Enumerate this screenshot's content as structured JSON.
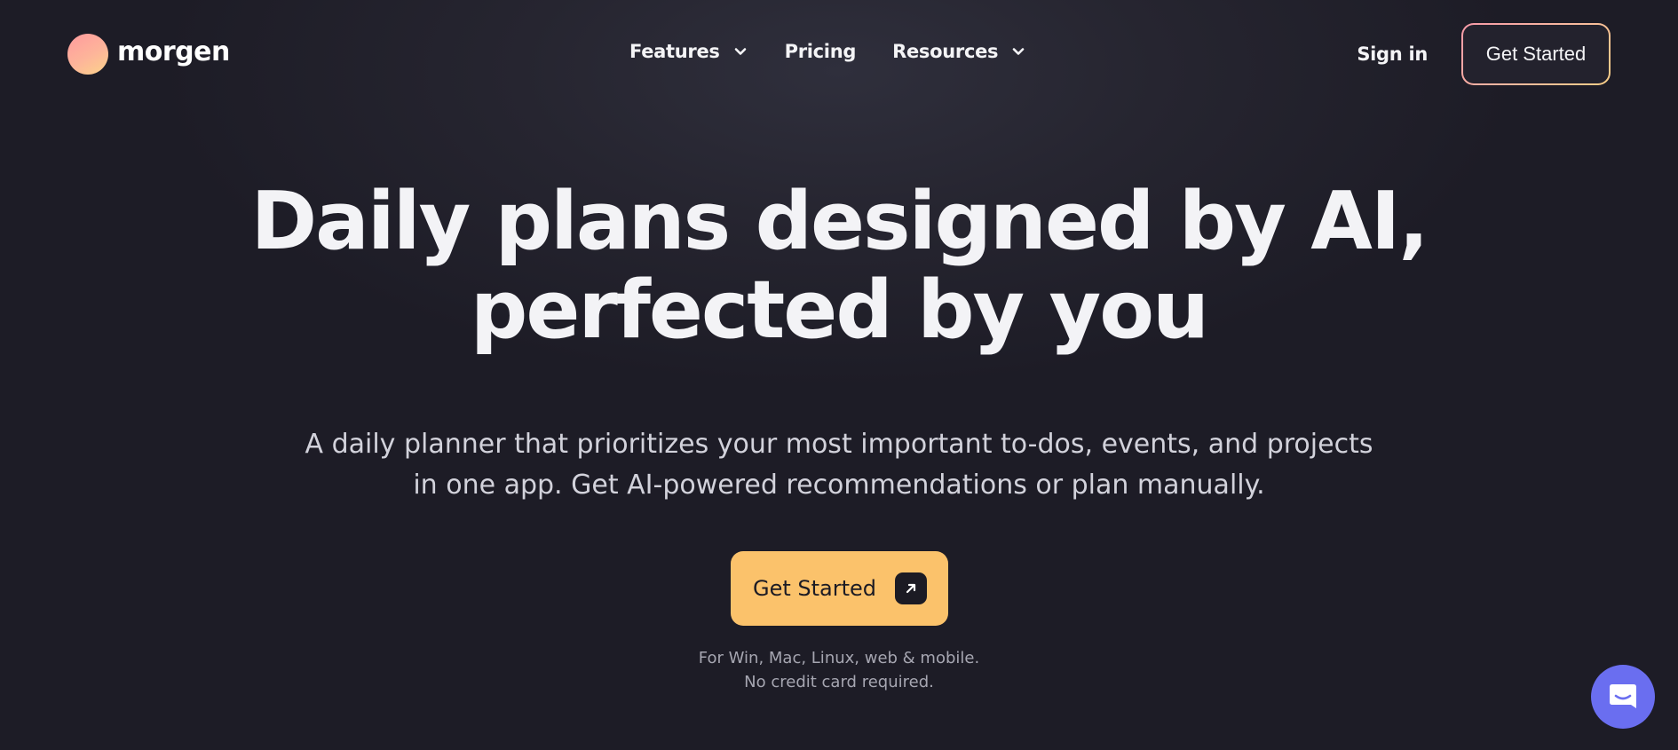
{
  "brand": {
    "name": "morgen",
    "logo_icon": "morgen-logo-icon"
  },
  "nav": {
    "items": [
      {
        "label": "Features",
        "has_dropdown": true
      },
      {
        "label": "Pricing",
        "has_dropdown": false
      },
      {
        "label": "Resources",
        "has_dropdown": true
      }
    ],
    "sign_in": "Sign in",
    "get_started": "Get Started"
  },
  "hero": {
    "title_line1": "Daily plans designed by AI,",
    "title_line2": "perfected by you",
    "subtitle_line1": "A daily planner that prioritizes your most important to-dos, events, and projects",
    "subtitle_line2": "in one app. Get AI-powered recommendations or plan manually.",
    "cta_label": "Get Started",
    "cta_icon": "arrow-up-right-icon",
    "note_line1": "For Win, Mac, Linux, web & mobile.",
    "note_line2": "No credit card required."
  },
  "chat_widget": {
    "icon": "chat-bubble-icon"
  },
  "colors": {
    "background": "#1d1c26",
    "cta": "#fbc26b",
    "chat": "#6a6ef0",
    "outline_gradient_start": "#f79aa8",
    "outline_gradient_end": "#f6cd87"
  }
}
